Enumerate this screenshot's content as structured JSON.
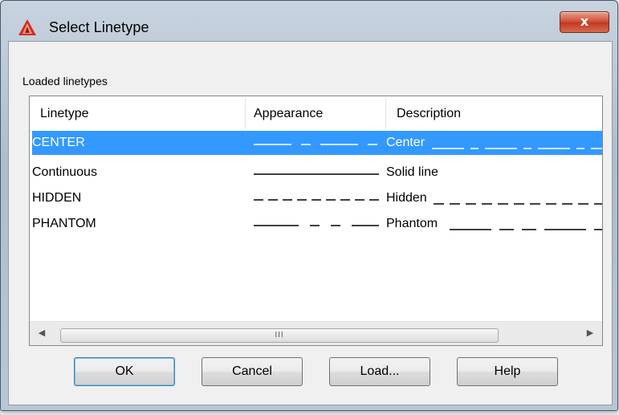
{
  "window": {
    "title": "Select Linetype",
    "close_label": "x"
  },
  "group_label": "Loaded linetypes",
  "columns": [
    "Linetype",
    "Appearance",
    "Description"
  ],
  "rows": [
    {
      "name": "CENTER",
      "description": "Center",
      "pattern": "center",
      "selected": true
    },
    {
      "name": "Continuous",
      "description": "Solid line",
      "pattern": "solid",
      "selected": false
    },
    {
      "name": "HIDDEN",
      "description": "Hidden",
      "pattern": "hidden",
      "selected": false
    },
    {
      "name": "PHANTOM",
      "description": "Phantom",
      "pattern": "phantom",
      "selected": false
    }
  ],
  "scrollbar": {
    "left_arrow": "◀",
    "right_arrow": "▶",
    "grip": "III"
  },
  "buttons": {
    "ok": "OK",
    "cancel": "Cancel",
    "load": "Load...",
    "help": "Help"
  },
  "colors": {
    "selection": "#3399ff",
    "close": "#c8452c",
    "logo": "#d22b2b"
  }
}
